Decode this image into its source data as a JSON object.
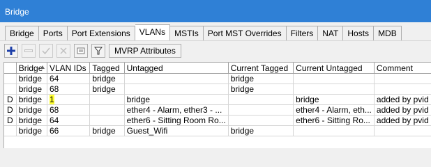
{
  "window": {
    "title": "Bridge"
  },
  "tabs": [
    {
      "label": "Bridge"
    },
    {
      "label": "Ports"
    },
    {
      "label": "Port Extensions"
    },
    {
      "label": "VLANs",
      "active": true
    },
    {
      "label": "MSTIs"
    },
    {
      "label": "Port MST Overrides"
    },
    {
      "label": "Filters"
    },
    {
      "label": "NAT"
    },
    {
      "label": "Hosts"
    },
    {
      "label": "MDB"
    }
  ],
  "toolbar": {
    "add_icon": "plus-icon",
    "remove_icon": "minus-icon",
    "enable_icon": "check-icon",
    "disable_icon": "x-icon",
    "comment_icon": "comment-icon",
    "filter_icon": "filter-icon",
    "mvrp_label": "MVRP Attributes"
  },
  "table": {
    "columns": [
      "",
      "Bridge",
      "VLAN IDs",
      "Tagged",
      "Untagged",
      "Current Tagged",
      "Current Untagged",
      "Comment"
    ],
    "rows": [
      [
        "",
        "bridge",
        "64",
        "bridge",
        "",
        "bridge",
        "",
        ""
      ],
      [
        "",
        "bridge",
        "68",
        "bridge",
        "",
        "bridge",
        "",
        ""
      ],
      [
        "D",
        "bridge",
        "1",
        "",
        "bridge",
        "",
        "bridge",
        "added by pvid"
      ],
      [
        "D",
        "bridge",
        "68",
        "",
        "ether4 - Alarm, ether3 - ...",
        "",
        "ether4 - Alarm, eth...",
        "added by pvid"
      ],
      [
        "D",
        "bridge",
        "64",
        "",
        "ether6 - Sitting Room Ro...",
        "",
        "ether6 - Sitting Ro...",
        "added by pvid"
      ],
      [
        "",
        "bridge",
        "66",
        "bridge",
        "Guest_Wifi",
        "bridge",
        "",
        ""
      ]
    ]
  },
  "colors": {
    "title_bar": "#2f80d6",
    "highlight": "#ffff33",
    "add_icon": "#1d3fa8"
  }
}
